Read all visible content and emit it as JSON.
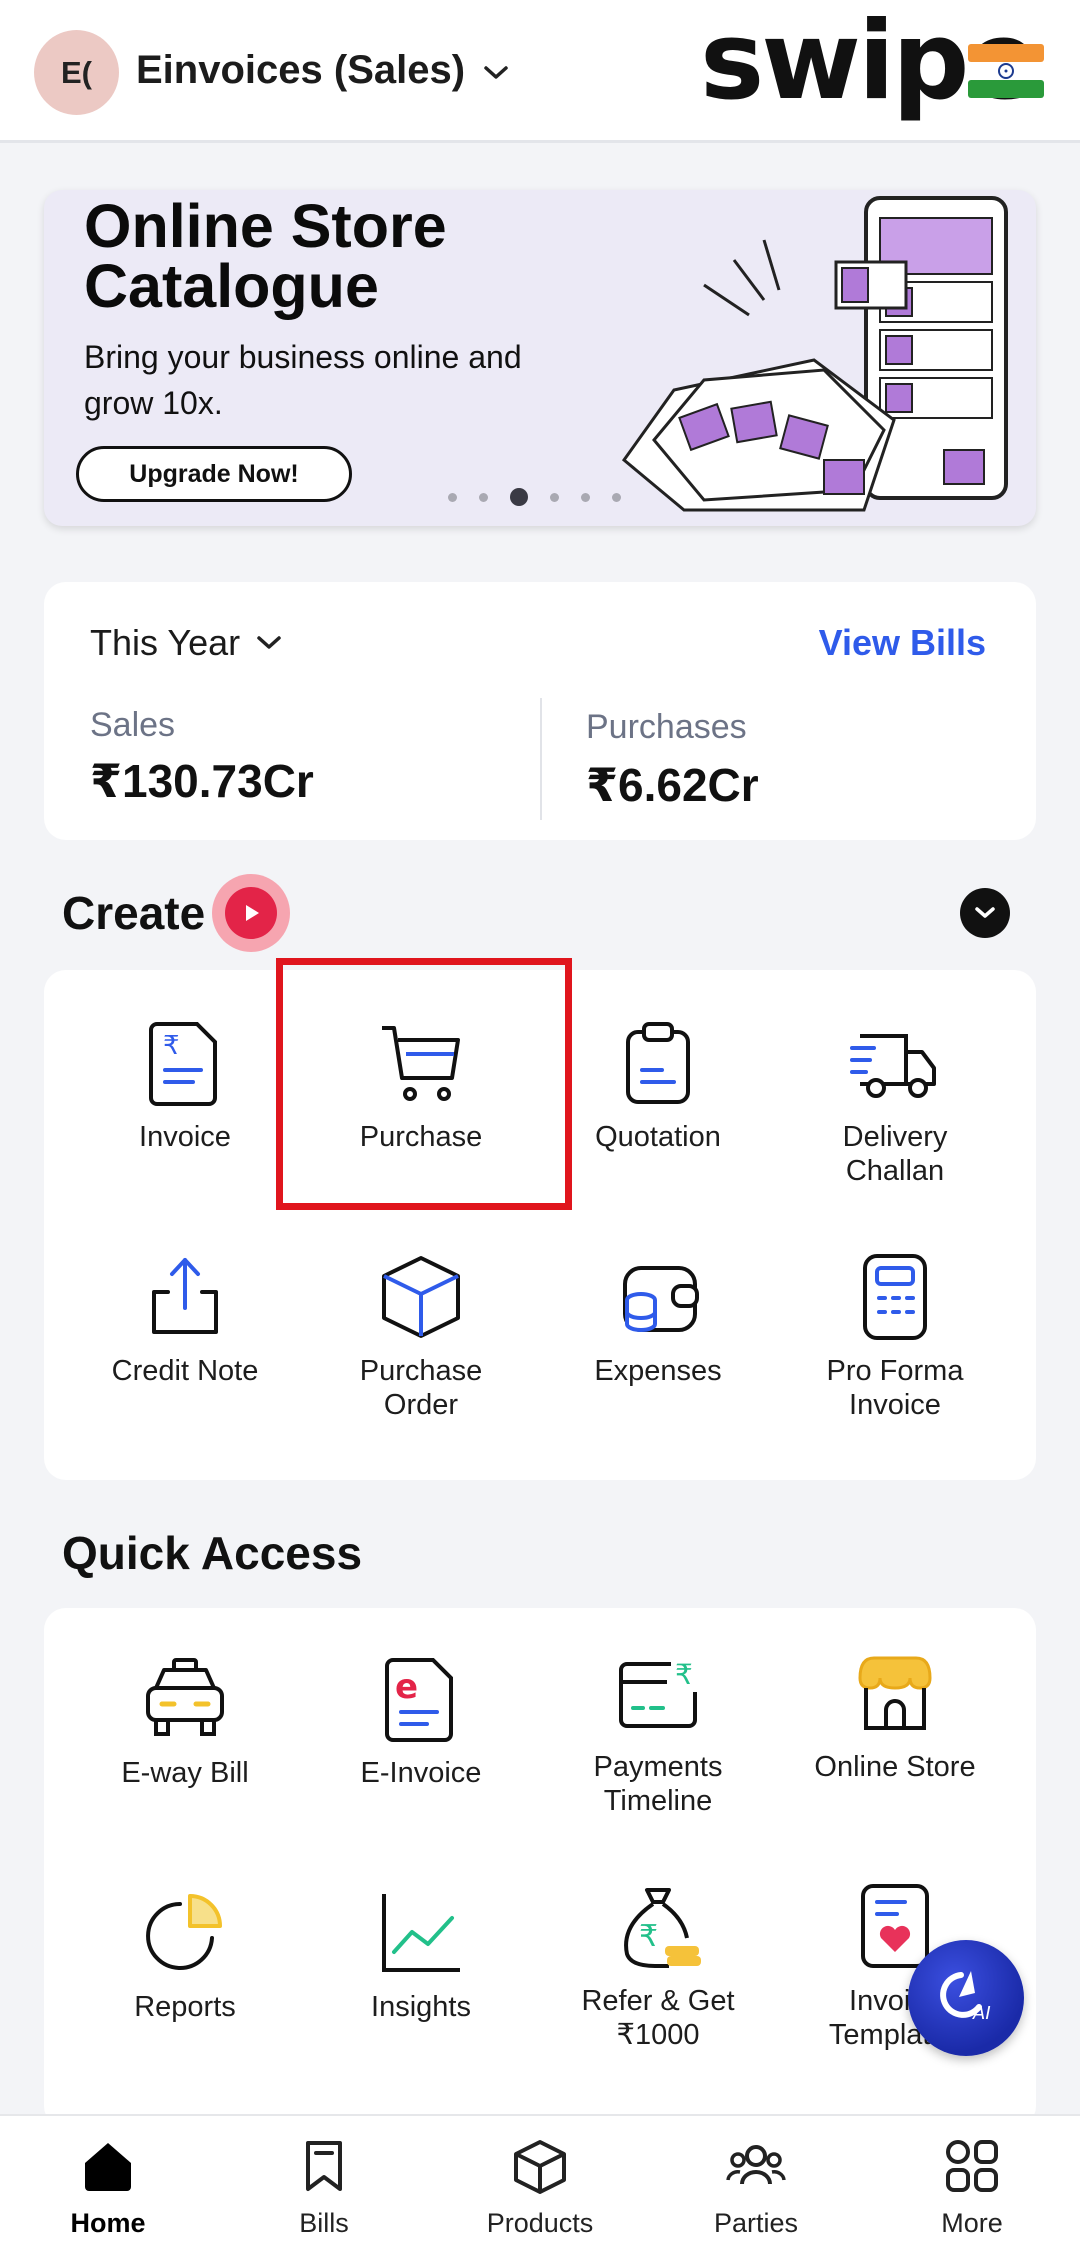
{
  "header": {
    "avatar_initials": "E(",
    "company_name": "Einvoices (Sales)",
    "brand": "swipe"
  },
  "banner": {
    "title": "Online Store Catalogue",
    "subtitle": "Bring your business online and grow 10x.",
    "cta_label": "Upgrade Now!",
    "slides_count": 6,
    "active_slide": 3
  },
  "stats": {
    "period": "This Year",
    "view_bills_label": "View Bills",
    "sales_label": "Sales",
    "sales_value": "₹130.73Cr",
    "purchases_label": "Purchases",
    "purchases_value": "₹6.62Cr"
  },
  "create": {
    "title": "Create",
    "items": [
      {
        "label": "Invoice",
        "icon": "invoice-icon"
      },
      {
        "label": "Purchase",
        "icon": "cart-icon"
      },
      {
        "label": "Quotation",
        "icon": "clipboard-icon"
      },
      {
        "label": "Delivery Challan",
        "icon": "truck-icon"
      },
      {
        "label": "Credit Note",
        "icon": "upload-icon"
      },
      {
        "label": "Purchase Order",
        "icon": "box-icon"
      },
      {
        "label": "Expenses",
        "icon": "wallet-icon"
      },
      {
        "label": "Pro Forma Invoice",
        "icon": "pos-icon"
      }
    ]
  },
  "quick_access": {
    "title": "Quick Access",
    "items": [
      {
        "label": "E-way Bill",
        "icon": "car-icon"
      },
      {
        "label": "E-Invoice",
        "icon": "e-invoice-icon"
      },
      {
        "label": "Payments Timeline",
        "icon": "payment-card-icon"
      },
      {
        "label": "Online Store",
        "icon": "store-icon"
      },
      {
        "label": "Reports",
        "icon": "pie-chart-icon"
      },
      {
        "label": "Insights",
        "icon": "line-chart-icon"
      },
      {
        "label": "Refer & Get ₹1000",
        "icon": "money-bag-icon"
      },
      {
        "label": "Invoice Templates",
        "icon": "template-icon"
      }
    ]
  },
  "ai": {
    "label": "AI"
  },
  "bottom_nav": {
    "items": [
      {
        "label": "Home",
        "icon": "home-icon",
        "active": true
      },
      {
        "label": "Bills",
        "icon": "bookmark-icon",
        "active": false
      },
      {
        "label": "Products",
        "icon": "box-icon",
        "active": false
      },
      {
        "label": "Parties",
        "icon": "users-icon",
        "active": false
      },
      {
        "label": "More",
        "icon": "grid-icon",
        "active": false
      }
    ]
  },
  "colors": {
    "accent_blue": "#2f5bea",
    "highlight_red": "#e0151d",
    "play_red": "#e32448",
    "background": "#f3f4f7"
  }
}
